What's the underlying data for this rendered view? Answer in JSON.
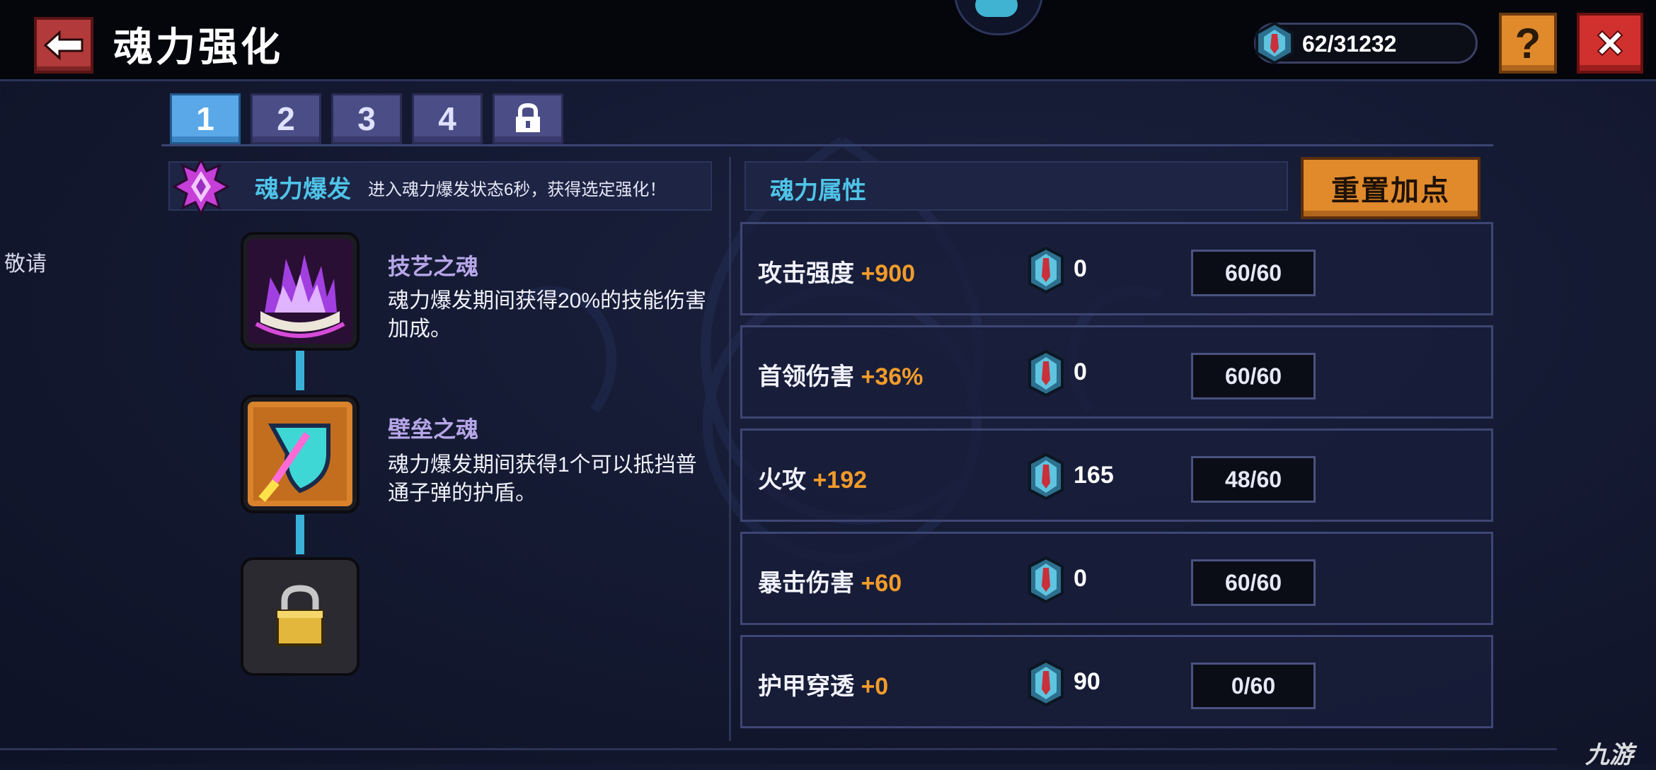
{
  "header": {
    "title": "魂力强化",
    "currency_value": "62/31232",
    "help_label": "?",
    "back_icon": "arrow-left-icon",
    "close_icon": "close-icon"
  },
  "side": {
    "text": "敬请"
  },
  "tabs": [
    {
      "label": "1",
      "active": true
    },
    {
      "label": "2",
      "active": false
    },
    {
      "label": "3",
      "active": false
    },
    {
      "label": "4",
      "active": false
    },
    {
      "label": "",
      "icon": "lock-icon",
      "active": false
    }
  ],
  "burst": {
    "title": "魂力爆发",
    "description": "进入魂力爆发状态6秒，获得选定强化！"
  },
  "skills": [
    {
      "name": "技艺之魂",
      "description": "魂力爆发期间获得20%的技能伤害加成。",
      "icon": "purple-flame-icon"
    },
    {
      "name": "壁垒之魂",
      "description": "魂力爆发期间获得1个可以抵挡普通子弹的护盾。",
      "icon": "shield-icon"
    },
    {
      "name": "",
      "description": "",
      "icon": "padlock-icon",
      "locked": true
    }
  ],
  "attributes": {
    "title": "魂力属性",
    "reset_label": "重置加点",
    "rows": [
      {
        "name": "攻击强度",
        "bonus": "+900",
        "cost": "0",
        "level": "60/60"
      },
      {
        "name": "首领伤害",
        "bonus": "+36%",
        "cost": "0",
        "level": "60/60"
      },
      {
        "name": "火攻",
        "bonus": "+192",
        "cost": "165",
        "level": "48/60"
      },
      {
        "name": "暴击伤害",
        "bonus": "+60",
        "cost": "0",
        "level": "60/60"
      },
      {
        "name": "护甲穿透",
        "bonus": "+0",
        "cost": "90",
        "level": "0/60"
      }
    ]
  },
  "watermark": "九游",
  "colors": {
    "accent_cyan": "#4fc3e8",
    "bonus_orange": "#f29b2a",
    "button_orange": "#e08a2c",
    "close_red": "#d0312f"
  }
}
